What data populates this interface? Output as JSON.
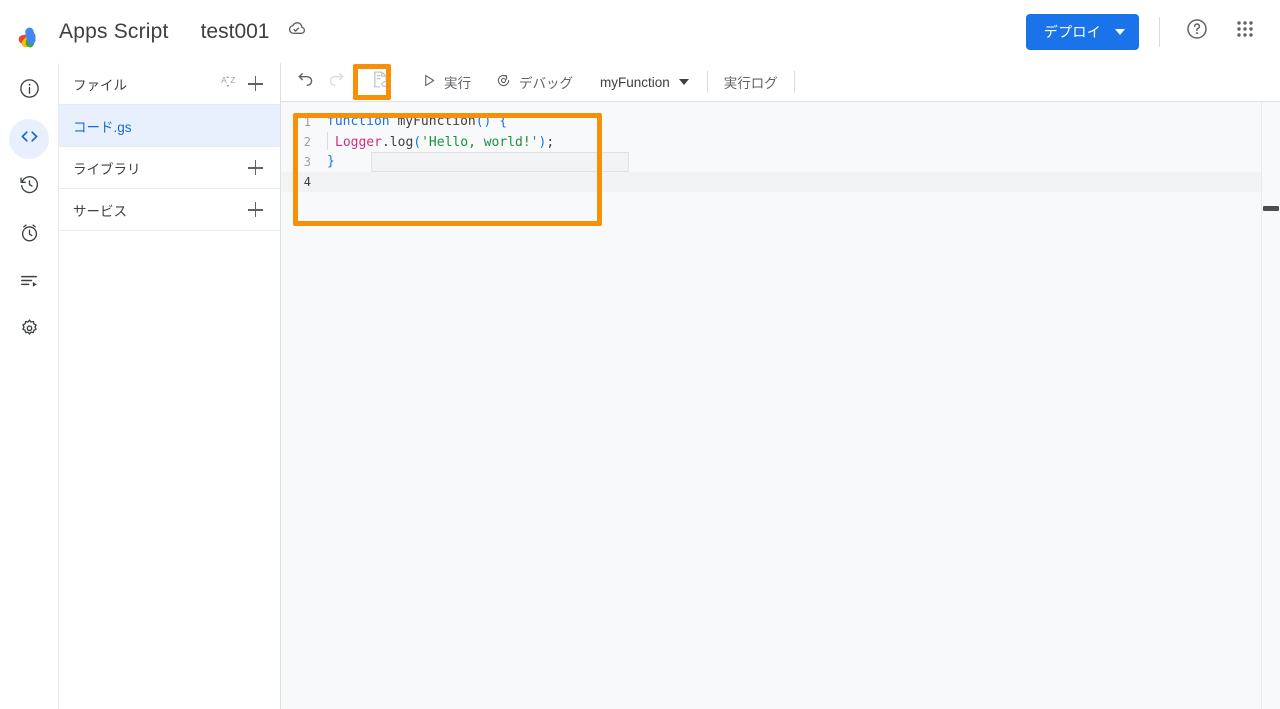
{
  "topbar": {
    "logo_icon": "apps-script-logo",
    "app_name": "Apps Script",
    "project_title": "test001",
    "drive_status_icon": "cloud-check-icon",
    "deploy_label": "デプロイ",
    "help_icon": "help-circle-icon",
    "apps_grid_icon": "apps-grid-icon",
    "accent_blue": "#1a73e8"
  },
  "rail": {
    "items": [
      {
        "name": "overview",
        "icon": "info-circle-icon",
        "selected": false
      },
      {
        "name": "editor",
        "icon": "code-brackets-icon",
        "selected": true
      },
      {
        "name": "history",
        "icon": "clock-history-icon",
        "selected": false
      },
      {
        "name": "triggers",
        "icon": "alarm-clock-icon",
        "selected": false
      },
      {
        "name": "executions",
        "icon": "list-play-icon",
        "selected": false
      },
      {
        "name": "settings",
        "icon": "gear-icon",
        "selected": false
      }
    ]
  },
  "filepanel": {
    "files_header": {
      "title": "ファイル",
      "sort_icon": "sort-alpha-icon",
      "sort_label_a": "A",
      "sort_label_z": "Z",
      "add_icon": "plus-icon"
    },
    "files": [
      {
        "base": "コード",
        "ext": ".gs",
        "full": "コード.gs",
        "active": true
      }
    ],
    "libraries_header": {
      "title": "ライブラリ",
      "add_icon": "plus-icon"
    },
    "services_header": {
      "title": "サービス",
      "add_icon": "plus-icon"
    }
  },
  "toolbar": {
    "undo_icon": "undo-arrow-icon",
    "redo_icon": "redo-arrow-icon",
    "save_icon": "save-to-cloud-icon",
    "save_enabled": false,
    "run_icon": "play-triangle-icon",
    "run_label": "実行",
    "debug_icon": "debug-bug-icon",
    "debug_label": "デバッグ",
    "function_selected": "myFunction",
    "function_caret_icon": "caret-down-icon",
    "exec_log_label": "実行ログ"
  },
  "editor": {
    "language": "javascript",
    "active_line": 4,
    "cursor_line": 4,
    "lines": [
      {
        "n": "1",
        "text": "function myFunction() {"
      },
      {
        "n": "2",
        "text": "  Logger.log('Hello, world!');"
      },
      {
        "n": "3",
        "text": "}"
      },
      {
        "n": "4",
        "text": ""
      }
    ],
    "tokens": {
      "l1_kw": "function",
      "l1_space": " ",
      "l1_name": "myFunction",
      "l1_parens": "()",
      "l1_tail": " ",
      "l1_brace": "{",
      "l2_builtin": "Logger",
      "l2_method": ".log",
      "l2_open": "(",
      "l2_string": "'Hello, world!'",
      "l2_close": ")",
      "l2_semi": ";",
      "l3_brace": "}"
    },
    "colors": {
      "keyword": "#1a73e8",
      "builtin": "#d0307e",
      "string": "#1e8e3e",
      "plain": "#3c4043",
      "gutter": "#9aa0a6",
      "background": "#f8f9fa"
    }
  },
  "annotations": {
    "highlight_color": "#f79009",
    "boxes": [
      {
        "name": "save-button-highlight",
        "target": "save-to-cloud-button"
      },
      {
        "name": "code-editor-highlight",
        "target": "code-editor-region"
      }
    ]
  }
}
